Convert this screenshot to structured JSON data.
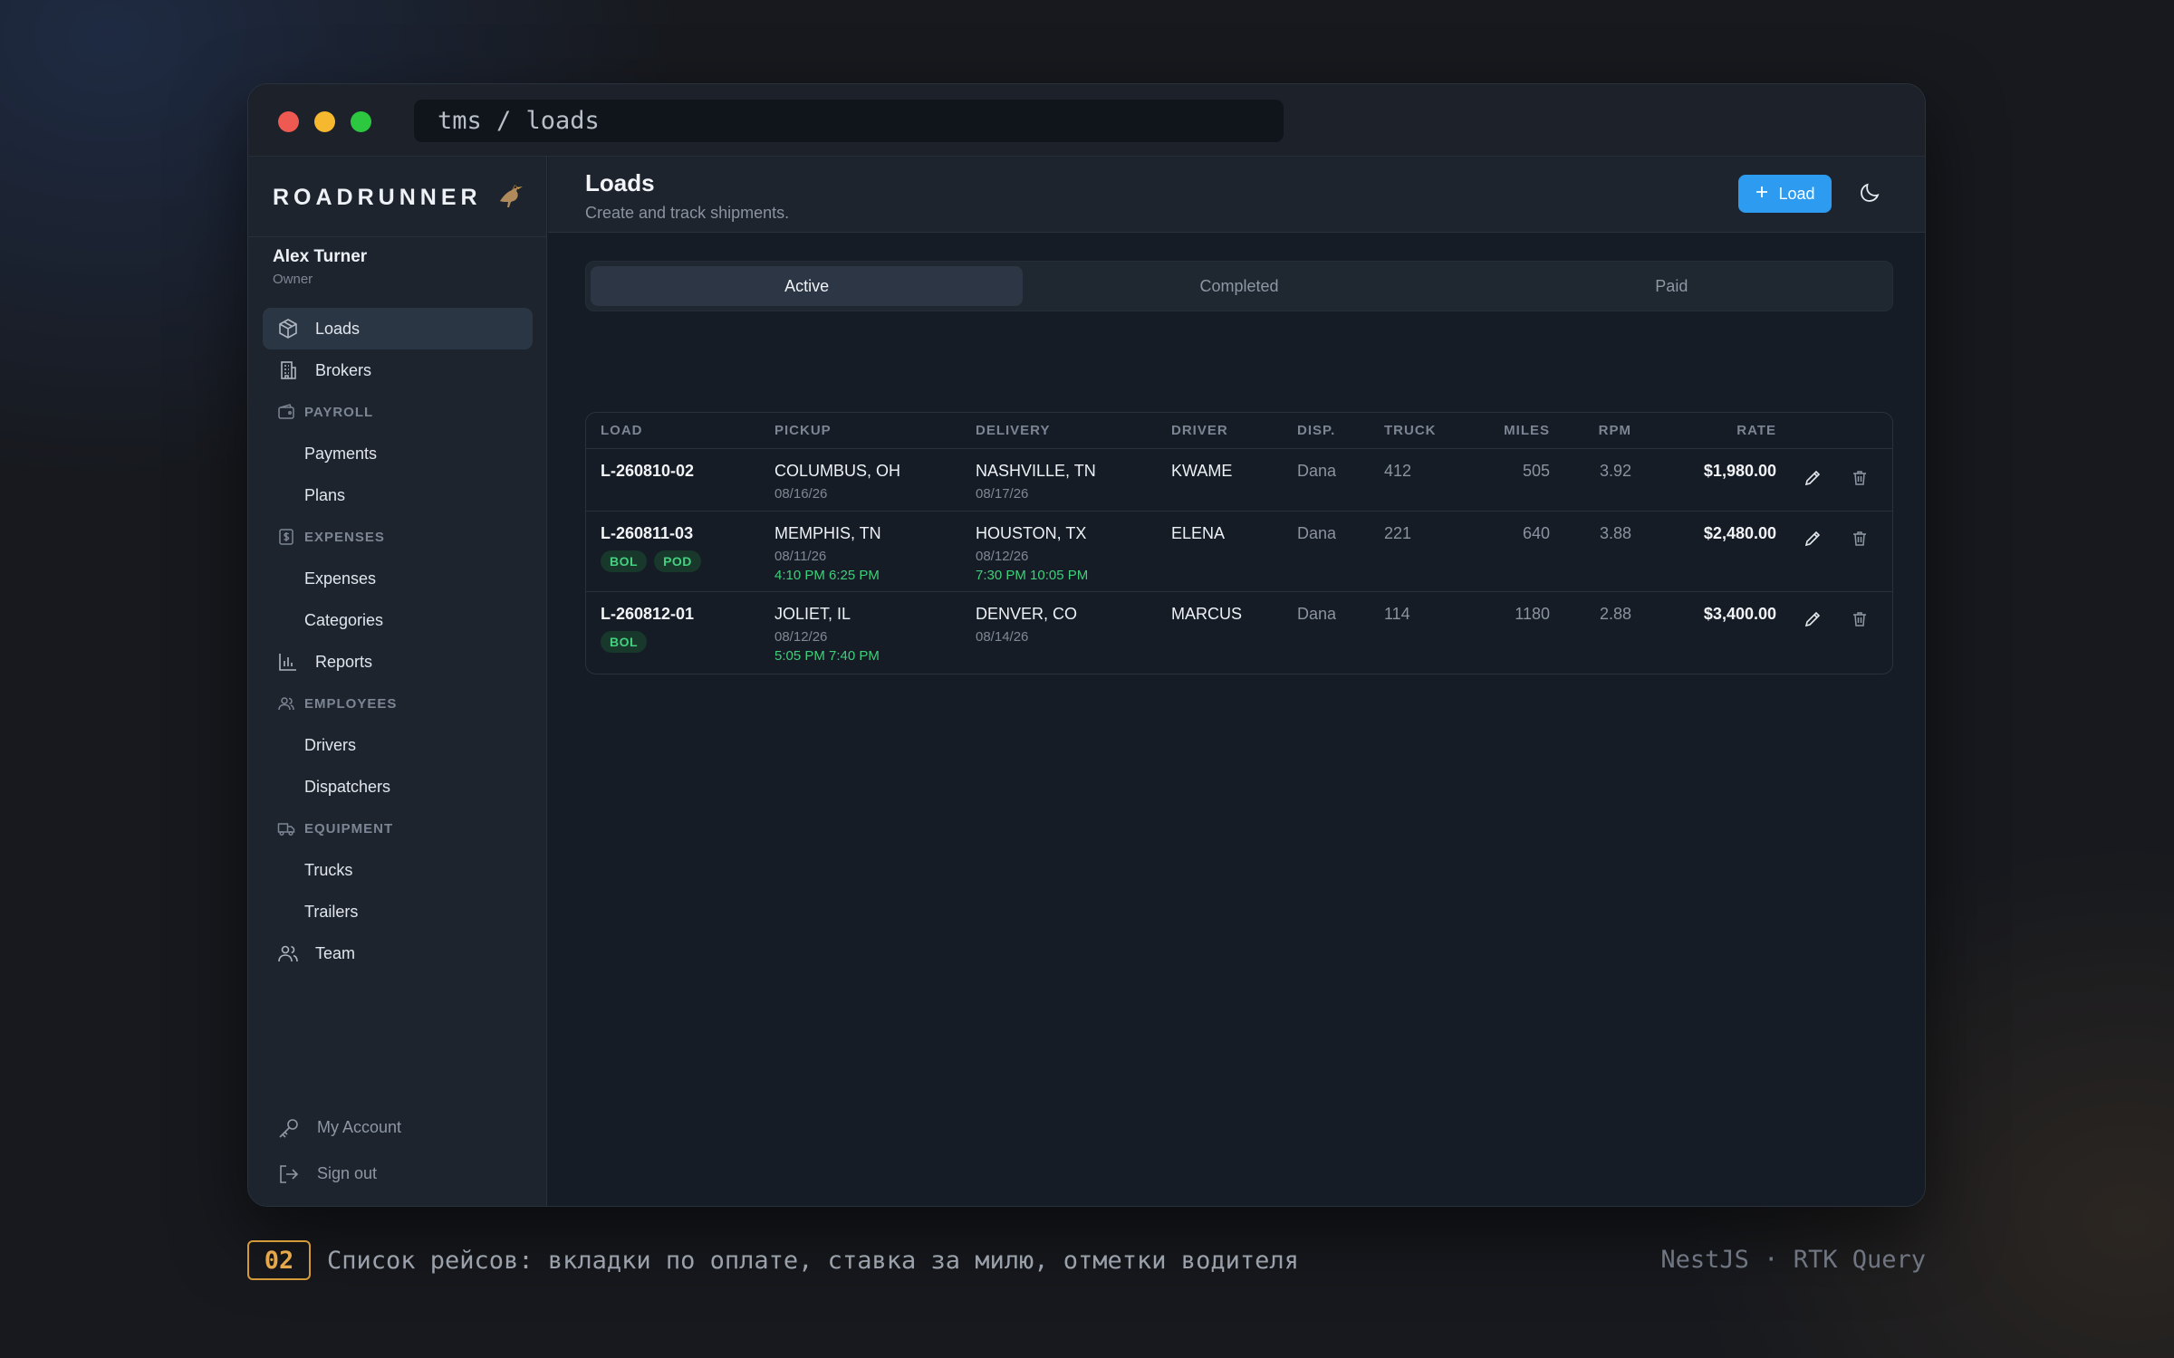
{
  "window": {
    "address": "tms / loads"
  },
  "brand": {
    "name": "ROADRUNNER"
  },
  "user": {
    "name": "Alex Turner",
    "role": "Owner"
  },
  "nav": {
    "loads": "Loads",
    "brokers": "Brokers",
    "payroll": "PAYROLL",
    "payments": "Payments",
    "plans": "Plans",
    "expenses_section": "EXPENSES",
    "expenses": "Expenses",
    "categories": "Categories",
    "reports": "Reports",
    "employees": "EMPLOYEES",
    "drivers": "Drivers",
    "dispatchers": "Dispatchers",
    "equipment": "EQUIPMENT",
    "trucks": "Trucks",
    "trailers": "Trailers",
    "team": "Team"
  },
  "footer": {
    "account": "My Account",
    "signout": "Sign out"
  },
  "header": {
    "title": "Loads",
    "subtitle": "Create and track shipments.",
    "add_label": "Load"
  },
  "tabs": [
    "Active",
    "Completed",
    "Paid"
  ],
  "columns": {
    "load": "LOAD",
    "pickup": "PICKUP",
    "delivery": "DELIVERY",
    "driver": "DRIVER",
    "disp": "DISP.",
    "truck": "TRUCK",
    "miles": "MILES",
    "rpm": "RPM",
    "rate": "RATE"
  },
  "rows": [
    {
      "load": "L-260810-02",
      "badges": [],
      "pickup_city": "COLUMBUS, OH",
      "pickup_date": "08/16/26",
      "pickup_time": "",
      "delivery_city": "NASHVILLE, TN",
      "delivery_date": "08/17/26",
      "delivery_time": "",
      "driver": "KWAME",
      "disp": "Dana",
      "truck": "412",
      "miles": "505",
      "rpm": "3.92",
      "rate": "$1,980.00"
    },
    {
      "load": "L-260811-03",
      "badges": [
        "BOL",
        "POD"
      ],
      "pickup_city": "MEMPHIS, TN",
      "pickup_date": "08/11/26",
      "pickup_time": "4:10 PM 6:25 PM",
      "delivery_city": "HOUSTON, TX",
      "delivery_date": "08/12/26",
      "delivery_time": "7:30 PM 10:05 PM",
      "driver": "ELENA",
      "disp": "Dana",
      "truck": "221",
      "miles": "640",
      "rpm": "3.88",
      "rate": "$2,480.00"
    },
    {
      "load": "L-260812-01",
      "badges": [
        "BOL"
      ],
      "pickup_city": "JOLIET, IL",
      "pickup_date": "08/12/26",
      "pickup_time": "5:05 PM 7:40 PM",
      "delivery_city": "DENVER, CO",
      "delivery_date": "08/14/26",
      "delivery_time": "",
      "driver": "MARCUS",
      "disp": "Dana",
      "truck": "114",
      "miles": "1180",
      "rpm": "2.88",
      "rate": "$3,400.00"
    }
  ],
  "caption": {
    "number": "02",
    "text": "Список рейсов: вкладки по оплате, ставка за милю, отметки водителя",
    "stack": "NestJS · RTK Query"
  },
  "colors": {
    "accent": "#2d9bf0",
    "success": "#3fcf7a",
    "caption_accent": "#e5a84a"
  }
}
